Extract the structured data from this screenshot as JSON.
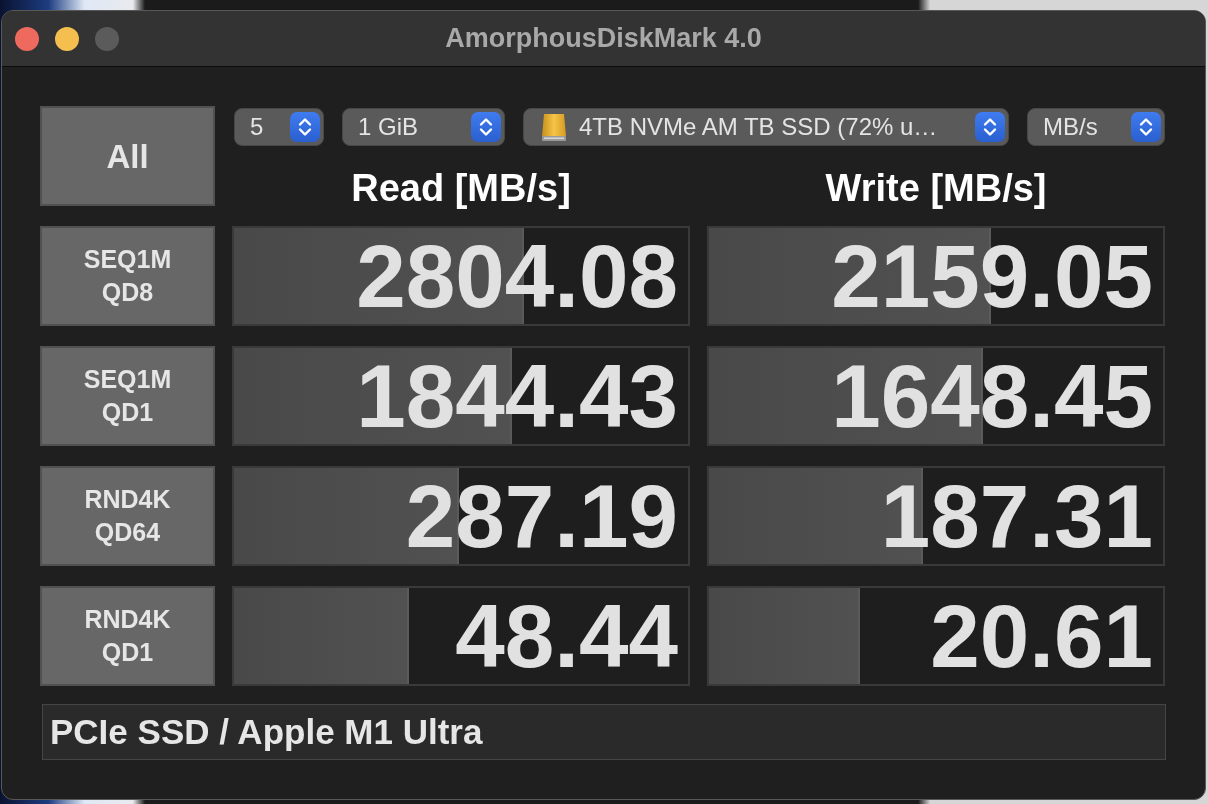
{
  "window": {
    "title": "AmorphousDiskMark 4.0",
    "buttons": [
      {
        "kind": "close",
        "disabled": false
      },
      {
        "kind": "minimize",
        "disabled": false
      },
      {
        "kind": "zoom",
        "disabled": true
      }
    ]
  },
  "all_button": {
    "label": "All"
  },
  "dropdowns": [
    {
      "kind": "count",
      "value": "5"
    },
    {
      "kind": "size",
      "value": "1 GiB"
    },
    {
      "kind": "drive",
      "value": "4TB NVMe AM TB SSD (72% u…"
    },
    {
      "kind": "unit",
      "value": "MB/s"
    }
  ],
  "columns": [
    "Read [MB/s]",
    "Write [MB/s]"
  ],
  "tests": [
    {
      "label": [
        "SEQ1M",
        "QD8"
      ],
      "results": [
        {
          "reading": "2804.08",
          "level": 0.639
        },
        {
          "reading": "2159.05",
          "level": 0.622
        }
      ]
    },
    {
      "label": [
        "SEQ1M",
        "QD1"
      ],
      "results": [
        {
          "reading": "1844.43",
          "level": 0.612
        },
        {
          "reading": "1648.45",
          "level": 0.604
        }
      ]
    },
    {
      "label": [
        "RND4K",
        "QD64"
      ],
      "results": [
        {
          "reading": "287.19",
          "level": 0.495
        },
        {
          "reading": "187.31",
          "level": 0.471
        }
      ]
    },
    {
      "label": [
        "RND4K",
        "QD1"
      ],
      "results": [
        {
          "reading": "48.44",
          "level": 0.386
        },
        {
          "reading": "20.61",
          "level": 0.333
        }
      ]
    }
  ],
  "comment": {
    "value": "PCIe SSD / Apple M1 Ultra"
  }
}
